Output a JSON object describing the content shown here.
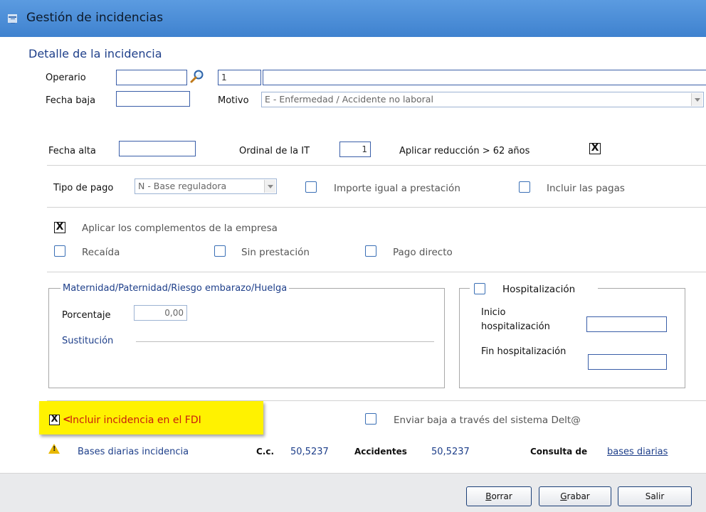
{
  "window": {
    "title": "Gestión de incidencias"
  },
  "section": {
    "title": "Detalle de la incidencia"
  },
  "operario": {
    "label": "Operario",
    "code_value": "",
    "number_value": "1",
    "name_value": ""
  },
  "fecha_baja": {
    "label": "Fecha baja",
    "value": ""
  },
  "motivo": {
    "label": "Motivo",
    "value": "E  - Enfermedad / Accidente no laboral"
  },
  "fecha_alta": {
    "label": "Fecha alta",
    "value": ""
  },
  "ordinal_it": {
    "label": "Ordinal de la IT",
    "value": "1"
  },
  "aplicar_reduccion": {
    "label": "Aplicar reducción > 62 años",
    "checked": true,
    "mark": "X"
  },
  "tipo_pago": {
    "label": "Tipo de pago",
    "value": "N - Base reguladora"
  },
  "importe_igual": {
    "label": "Importe igual a prestación",
    "checked": false
  },
  "incluir_pagas": {
    "label": "Incluir las pagas",
    "checked": false
  },
  "complementos": {
    "label": "Aplicar los complementos de la empresa",
    "checked": true,
    "mark": "X"
  },
  "recaida": {
    "label": "Recaída",
    "checked": false
  },
  "sin_prestacion": {
    "label": "Sin prestación",
    "checked": false
  },
  "pago_directo": {
    "label": "Pago directo",
    "checked": false
  },
  "maternidad": {
    "legend": "Maternidad/Paternidad/Riesgo embarazo/Huelga",
    "porcentaje_label": "Porcentaje",
    "porcentaje_value": "0,00",
    "sustitucion_label": "Sustitución"
  },
  "hospitalizacion": {
    "legend": "Hospitalización",
    "checked": false,
    "inicio_label_1": "Inicio",
    "inicio_label_2": "hospitalización",
    "inicio_value": "",
    "fin_label": "Fin hospitalización",
    "fin_value": ""
  },
  "incluir_fdi": {
    "label": "Incluir incidencia en el FDI",
    "checked": true,
    "mark": "X",
    "arrow": "<"
  },
  "delta": {
    "label": "Enviar baja a través del sistema Delt@",
    "checked": false
  },
  "bases": {
    "label": "Bases diarias incidencia",
    "cc_label": "C.c.",
    "cc_value": "50,5237",
    "acc_label": "Accidentes",
    "acc_value": "50,5237",
    "consulta_label": "Consulta de",
    "consulta_link": "bases diarias"
  },
  "buttons": {
    "borrar": {
      "first": "B",
      "rest": "orrar"
    },
    "grabar": {
      "first": "G",
      "rest": "rabar"
    },
    "salir": {
      "label": "Salir"
    }
  },
  "colors": {
    "titlebar": "#4d8fd8",
    "section_title": "#1e3f8a",
    "highlight": "#fff200",
    "fdi_text": "#c81e0e",
    "warning": "#e8b800"
  },
  "icons": [
    "window-icon",
    "search-icon",
    "warning-icon",
    "dropdown-arrow-icon"
  ]
}
